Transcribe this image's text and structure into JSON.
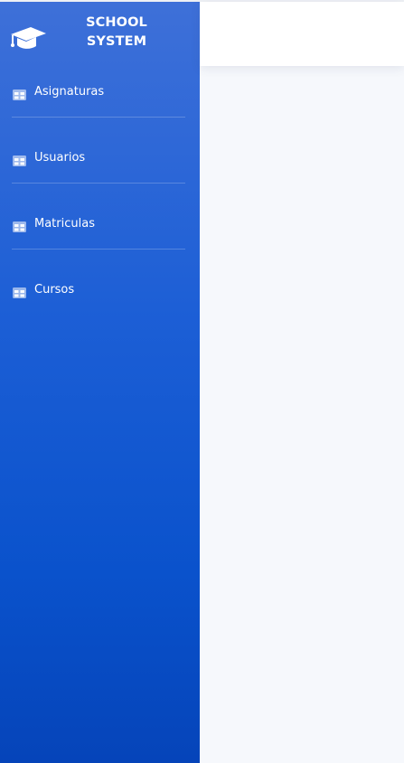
{
  "brand": {
    "line1": "SCHOOL",
    "line2": "SYSTEM",
    "icon": "graduation-cap-icon"
  },
  "sidebar": {
    "items": [
      {
        "label": "Asignaturas",
        "icon": "table-icon"
      },
      {
        "label": "Usuarios",
        "icon": "table-icon"
      },
      {
        "label": "Matriculas",
        "icon": "table-icon"
      },
      {
        "label": "Cursos",
        "icon": "table-icon"
      }
    ]
  },
  "colors": {
    "sidebar_top": "#3e70d8",
    "sidebar_bottom": "#0544b9",
    "content_background": "#f6f8fc",
    "topbar_background": "#ffffff"
  }
}
